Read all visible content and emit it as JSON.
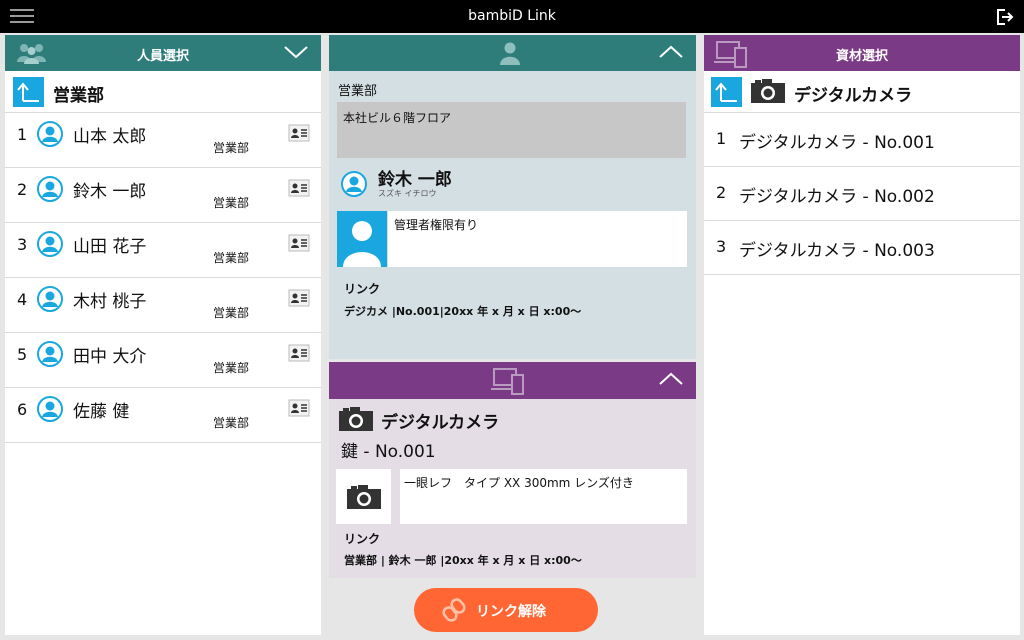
{
  "app": {
    "title": "bambiD Link"
  },
  "people": {
    "header": "人員選択",
    "department": "営業部",
    "list": [
      {
        "num": "1",
        "name": "山本 太郎",
        "dept": "営業部"
      },
      {
        "num": "2",
        "name": "鈴木 一郎",
        "dept": "営業部"
      },
      {
        "num": "3",
        "name": "山田 花子",
        "dept": "営業部"
      },
      {
        "num": "4",
        "name": "木村 桃子",
        "dept": "営業部"
      },
      {
        "num": "5",
        "name": "田中 大介",
        "dept": "営業部"
      },
      {
        "num": "6",
        "name": "佐藤 健",
        "dept": "営業部"
      }
    ]
  },
  "person_detail": {
    "dept": "営業部",
    "location": "本社ビル６階フロア",
    "name": "鈴木 一郎",
    "kana": "スズキ イチロウ",
    "note": "管理者権限有り",
    "link_label": "リンク",
    "link_value": "デジカメ |No.001|20xx 年 x 月 x 日 x:00～"
  },
  "material_detail": {
    "name": "デジタルカメラ",
    "sub": "鍵 - No.001",
    "note": "一眼レフ　タイプ XX 300mm レンズ付き",
    "link_label": "リンク",
    "link_value": "営業部 | 鈴木 一郎 |20xx 年 x 月 x 日 x:00～"
  },
  "unlink_button": "リンク解除",
  "materials": {
    "header": "資材選択",
    "category": "デジタルカメラ",
    "list": [
      {
        "num": "1",
        "name": "デジタルカメラ - No.001"
      },
      {
        "num": "2",
        "name": "デジタルカメラ - No.002"
      },
      {
        "num": "3",
        "name": "デジタルカメラ - No.003"
      }
    ]
  },
  "colors": {
    "teal": "#2e7d7b",
    "purple": "#7a3a85",
    "accent": "#1aa7df",
    "orange": "#ff6633"
  }
}
